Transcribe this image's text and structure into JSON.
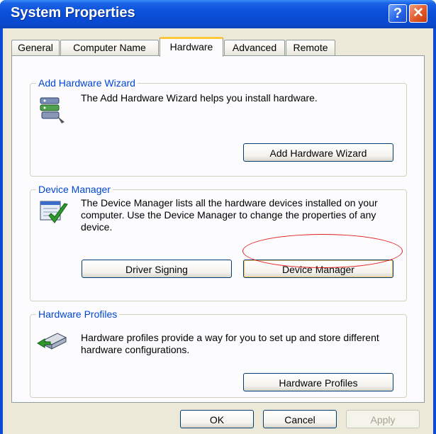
{
  "window": {
    "title": "System Properties",
    "help_glyph": "?",
    "close_glyph": "✕"
  },
  "tabs": [
    {
      "label": "General"
    },
    {
      "label": "Computer Name"
    },
    {
      "label": "Hardware"
    },
    {
      "label": "Advanced"
    },
    {
      "label": "Remote"
    }
  ],
  "active_tab": "Hardware",
  "add_hardware": {
    "group_label": "Add Hardware Wizard",
    "description": "The Add Hardware Wizard helps you install hardware.",
    "button_label": "Add Hardware Wizard",
    "icon": "add-hardware-icon"
  },
  "device_manager": {
    "group_label": "Device Manager",
    "description": "The Device Manager lists all the hardware devices installed on your computer. Use the Device Manager to change the properties of any device.",
    "driver_signing_label": "Driver Signing",
    "device_manager_label": "Device Manager",
    "icon": "device-manager-icon",
    "highlight_color": "#e02020"
  },
  "hardware_profiles": {
    "group_label": "Hardware Profiles",
    "description": "Hardware profiles provide a way for you to set up and store different hardware configurations.",
    "button_label": "Hardware Profiles",
    "icon": "hardware-profiles-icon"
  },
  "footer": {
    "ok_label": "OK",
    "cancel_label": "Cancel",
    "apply_label": "Apply"
  },
  "colors": {
    "title_bar": "#0a49d0",
    "group_label": "#0046d5",
    "dialog_bg": "#ece9d8"
  }
}
